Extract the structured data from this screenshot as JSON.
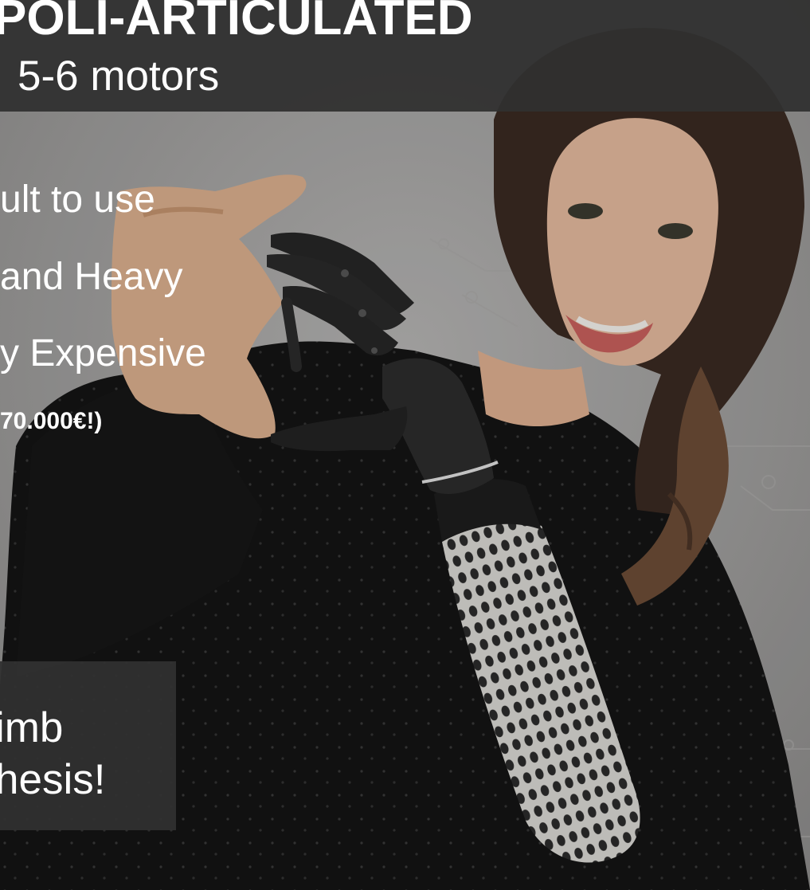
{
  "slide": {
    "title": "POLI-ARTICULATED",
    "subtitle": "5-6 motors",
    "bullets": [
      "ult to use",
      " and Heavy",
      "y Expensive",
      "70.000€!)"
    ],
    "callout": {
      "line1": "imb",
      "line2": "hesis!"
    },
    "photo_icon": "woman-with-bionic-hand-photo"
  },
  "colors": {
    "header_bg": "#303030",
    "callout_bg": "#303030",
    "text": "#ffffff"
  }
}
